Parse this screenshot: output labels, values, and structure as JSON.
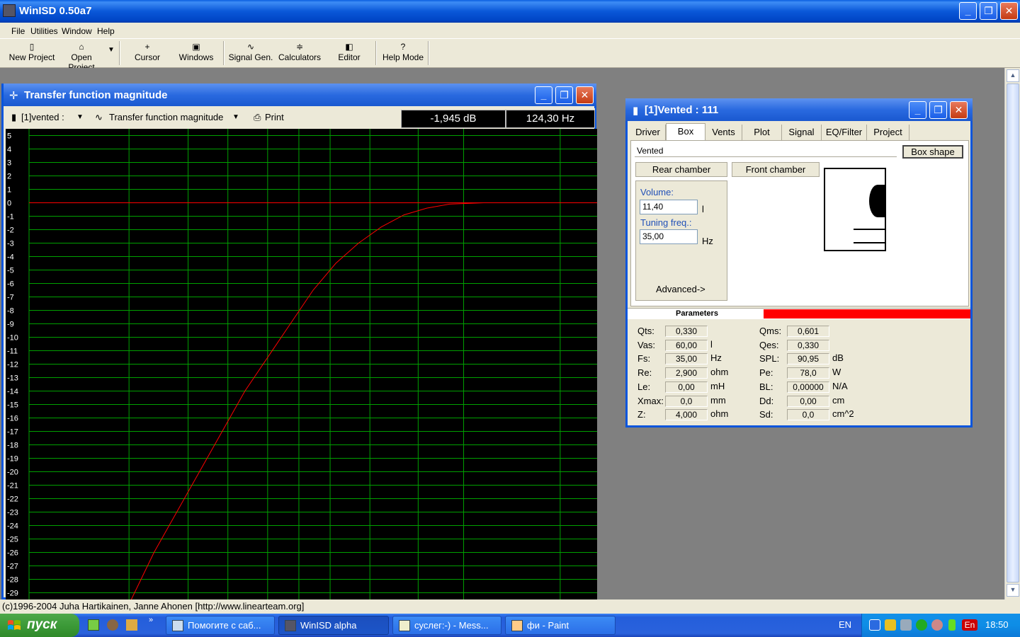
{
  "app": {
    "title": "WinISD 0.50a7"
  },
  "menu": {
    "items": [
      "File",
      "Utilities",
      "Window",
      "Help"
    ]
  },
  "toolbar": {
    "new_project": "New Project",
    "open_project": "Open Project",
    "cursor": "Cursor",
    "windows": "Windows",
    "signal_gen": "Signal Gen.",
    "calculators": "Calculators",
    "editor": "Editor",
    "help_mode": "Help Mode",
    "help_glyph": "?"
  },
  "tf_window": {
    "title": "Transfer function magnitude",
    "project_select": "[1]vented :",
    "graph_select": "Transfer function magnitude",
    "print": "Print",
    "readout_db": "-1,945 dB",
    "readout_hz": "124,30 Hz"
  },
  "chart_data": {
    "type": "line",
    "title": "",
    "xlabel": "",
    "ylabel": "",
    "ylim": [
      -29.5,
      5.5
    ],
    "y_ticks": [
      5,
      4,
      3,
      2,
      1,
      0,
      -1,
      -2,
      -3,
      -4,
      -5,
      -6,
      -7,
      -8,
      -9,
      -10,
      -11,
      -12,
      -13,
      -14,
      -15,
      -16,
      -17,
      -18,
      -19,
      -20,
      -21,
      -22,
      -23,
      -24,
      -25,
      -26,
      -27,
      -28,
      -29
    ],
    "grid": true,
    "series": [
      {
        "color": "#ff0000",
        "points": [
          [
            0.18,
            -29.5
          ],
          [
            0.22,
            -26
          ],
          [
            0.26,
            -23
          ],
          [
            0.3,
            -20
          ],
          [
            0.34,
            -17
          ],
          [
            0.38,
            -14
          ],
          [
            0.42,
            -11.5
          ],
          [
            0.46,
            -9
          ],
          [
            0.5,
            -6.5
          ],
          [
            0.54,
            -4.5
          ],
          [
            0.58,
            -3
          ],
          [
            0.62,
            -1.8
          ],
          [
            0.66,
            -0.9
          ],
          [
            0.7,
            -0.4
          ],
          [
            0.74,
            -0.1
          ],
          [
            0.8,
            0
          ],
          [
            1.0,
            0
          ]
        ]
      }
    ]
  },
  "vented_window": {
    "title": "[1]Vented : 111",
    "tabs": [
      "Driver",
      "Box",
      "Vents",
      "Plot",
      "Signal",
      "EQ/Filter",
      "Project"
    ],
    "active_tab": "Box",
    "box_type": "Vented",
    "box_shape_button": "Box shape",
    "rear_chamber": "Rear chamber",
    "front_chamber": "Front chamber",
    "volume_label": "Volume:",
    "volume_value": "11,40",
    "volume_unit": "l",
    "tuning_label": "Tuning freq.:",
    "tuning_value": "35,00",
    "tuning_unit": "Hz",
    "advanced": "Advanced->",
    "parameters_header": "Parameters",
    "left_params": [
      {
        "label": "Qts:",
        "value": "0,330",
        "unit": ""
      },
      {
        "label": "Vas:",
        "value": "60,00",
        "unit": "l"
      },
      {
        "label": "Fs:",
        "value": "35,00",
        "unit": "Hz"
      },
      {
        "label": "Re:",
        "value": "2,900",
        "unit": "ohm"
      },
      {
        "label": "Le:",
        "value": "0,00",
        "unit": "mH"
      },
      {
        "label": "Xmax:",
        "value": "0,0",
        "unit": "mm"
      },
      {
        "label": "Z:",
        "value": "4,000",
        "unit": "ohm"
      }
    ],
    "right_params": [
      {
        "label": "Qms:",
        "value": "0,601",
        "unit": ""
      },
      {
        "label": "Qes:",
        "value": "0,330",
        "unit": ""
      },
      {
        "label": "SPL:",
        "value": "90,95",
        "unit": "dB"
      },
      {
        "label": "Pe:",
        "value": "78,0",
        "unit": "W"
      },
      {
        "label": "BL:",
        "value": "0,00000",
        "unit": "N/A"
      },
      {
        "label": "Dd:",
        "value": "0,00",
        "unit": "cm"
      },
      {
        "label": "Sd:",
        "value": "0,0",
        "unit": "cm^2"
      }
    ]
  },
  "status": {
    "text": "(c)1996-2004 Juha Hartikainen, Janne Ahonen [http://www.linearteam.org]"
  },
  "taskbar": {
    "start": "пуск",
    "tasks": [
      "Помогите с саб...",
      "WinISD alpha",
      "суслег:-) - Mess...",
      "фи - Paint"
    ],
    "lang": "EN",
    "lang2": "En",
    "clock": "18:50"
  }
}
